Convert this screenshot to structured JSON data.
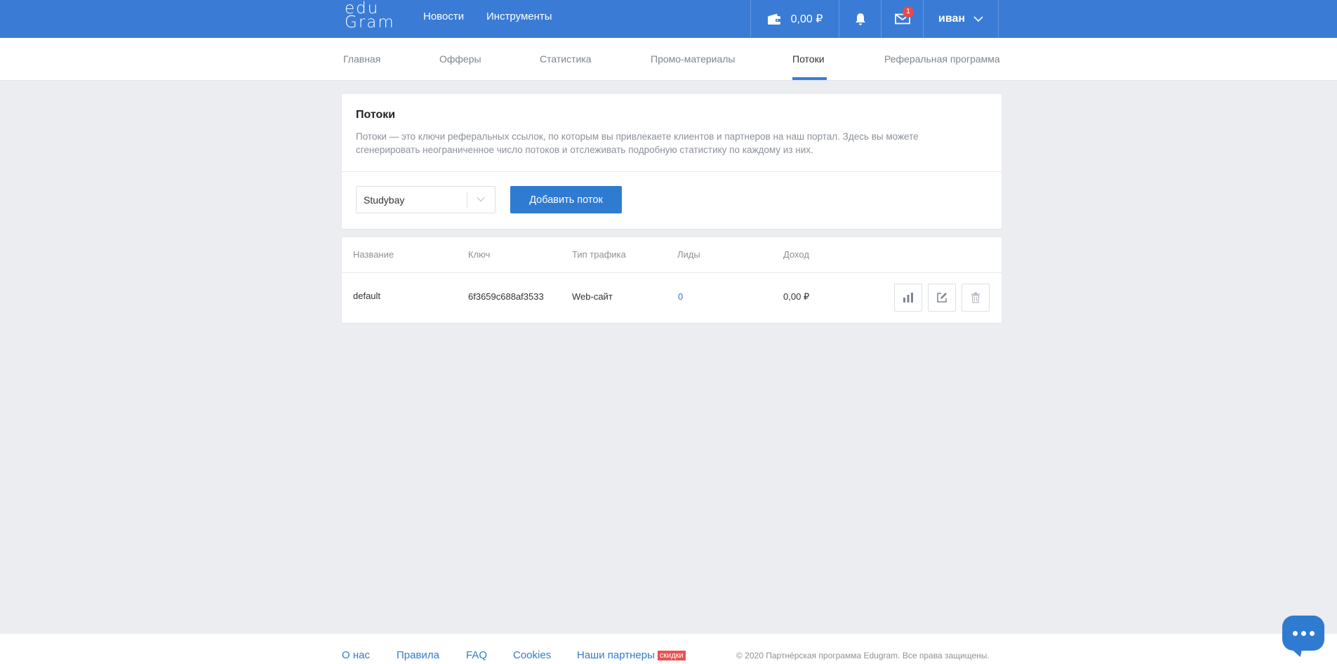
{
  "brand": {
    "logo_line1": "edu",
    "logo_line2": "Gram"
  },
  "topnav": [
    {
      "label": "Новости"
    },
    {
      "label": "Инструменты"
    }
  ],
  "header": {
    "balance": "0,00 ₽",
    "mail_badge": "1",
    "user_name": "иван"
  },
  "subnav": [
    {
      "label": "Главная",
      "active": false
    },
    {
      "label": "Офферы",
      "active": false
    },
    {
      "label": "Статистика",
      "active": false
    },
    {
      "label": "Промо-материалы",
      "active": false
    },
    {
      "label": "Потоки",
      "active": true
    },
    {
      "label": "Реферальная программа",
      "active": false
    }
  ],
  "info": {
    "title": "Потоки",
    "description": "Потоки — это ключи реферальных ссылок, по которым вы привлекаете клиентов и партнеров на наш портал. Здесь вы можете сгенерировать неограниченное число потоков и отслеживать подробную статистику по каждому из них.",
    "select_value": "Studybay",
    "add_button": "Добавить поток"
  },
  "table": {
    "headers": [
      "Название",
      "Ключ",
      "Тип трафика",
      "Лиды",
      "Доход"
    ],
    "rows": [
      {
        "name": "default",
        "key": "6f3659c688af3533",
        "traffic": "Web-сайт",
        "leads": "0",
        "income": "0,00 ₽"
      }
    ]
  },
  "footer": {
    "links": [
      "О нас",
      "Правила",
      "FAQ",
      "Cookies",
      "Наши партнеры"
    ],
    "partners_tag": "скидки",
    "copyright": "© 2020 Партнёрская программа Edugram. Все права защищены."
  },
  "colors": {
    "primary": "#3a7bd5",
    "button": "#2f7bd2",
    "badge": "#e84b4b",
    "tag": "#ef4f4f"
  }
}
